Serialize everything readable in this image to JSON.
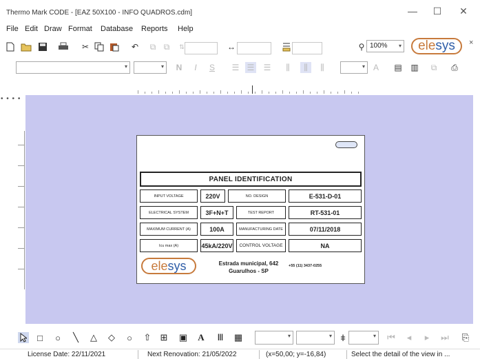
{
  "window": {
    "title": "Thermo Mark CODE - [EAZ 50X100 - INFO QUADROS.cdm]",
    "minimize": "—",
    "maximize": "☐",
    "close": "✕"
  },
  "menu": [
    "File",
    "Edit",
    "Draw",
    "Format",
    "Database",
    "Reports",
    "Help"
  ],
  "toolbar": {
    "zoom": "100%",
    "brand_ele": "ele",
    "brand_sys": "sys",
    "brand_close": "×"
  },
  "label": {
    "header": "PANEL IDENTIFICATION",
    "rows": [
      {
        "l1": "INPUT VOLTAGE",
        "v1": "220V",
        "l2": "NO. DESIGN",
        "v2": "E-531-D-01"
      },
      {
        "l1": "ELECTRICAL SYSTEM",
        "v1": "3F+N+T",
        "l2": "TEST REPORT",
        "v2": "RT-531-01"
      },
      {
        "l1": "MAXIMUM CURRENT (A)",
        "v1": "100A",
        "l2": "MANUFACTURING DATE",
        "v2": "07/11/2018"
      },
      {
        "l1": "Icu max (A)",
        "v1": "45kA/220V",
        "l2": "CONTROL VOLTAGE",
        "v2": "NA"
      }
    ],
    "logo_ele": "ele",
    "logo_sys": "sys",
    "address_line1": "Estrada municipal, 642",
    "address_line2": "Guarulhos - SP",
    "phone": "+55 (11) 3437-0255"
  },
  "status": {
    "license": "License Date: 22/11/2021",
    "renovation": "Next Renovation: 21/05/2022",
    "coords": "(x=50,00; y=-16,84)",
    "hint": "Select the detail of the view in ..."
  },
  "colors": {
    "canvas_bg": "#c8c8f0",
    "brand_orange": "#c77a3c",
    "brand_blue": "#2f5ea8"
  }
}
